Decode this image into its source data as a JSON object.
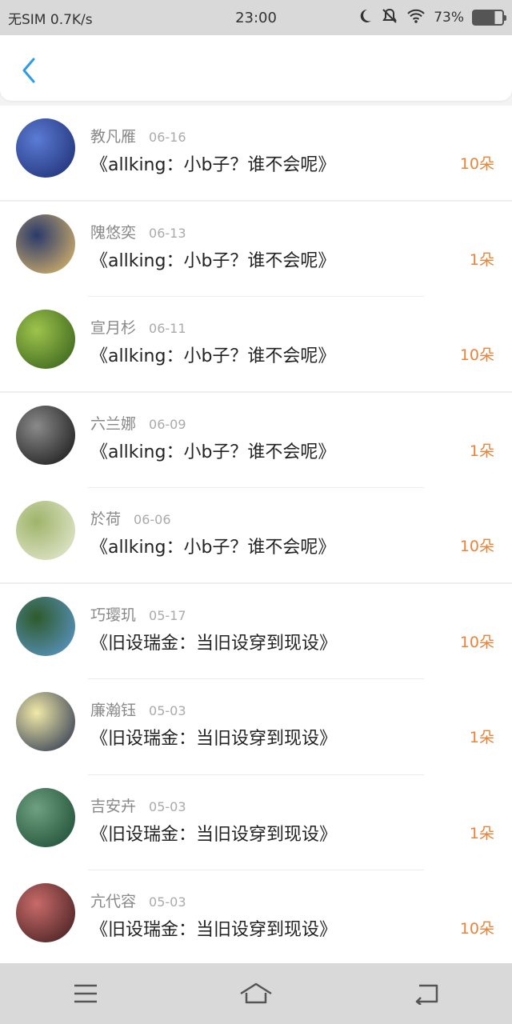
{
  "status_bar": {
    "carrier": "无SIM 0.7K/s",
    "time": "23:00",
    "battery": "73%"
  },
  "list": [
    {
      "name": "教凡雁",
      "date": "06-16",
      "title": "《allking：小b子？谁不会呢》",
      "gift": "10朵",
      "avatar_colors": [
        "#1a2a6c",
        "#5b7bd5"
      ]
    },
    {
      "name": "隗悠奕",
      "date": "06-13",
      "title": "《allking：小b子？谁不会呢》",
      "gift": "1朵",
      "avatar_colors": [
        "#e8c06a",
        "#2a3a6a"
      ]
    },
    {
      "name": "宣月杉",
      "date": "06-11",
      "title": "《allking：小b子？谁不会呢》",
      "gift": "10朵",
      "avatar_colors": [
        "#2f5a18",
        "#9ec44c"
      ]
    },
    {
      "name": "六兰娜",
      "date": "06-09",
      "title": "《allking：小b子？谁不会呢》",
      "gift": "1朵",
      "avatar_colors": [
        "#111111",
        "#8a8a8a"
      ]
    },
    {
      "name": "於荷",
      "date": "06-06",
      "title": "《allking：小b子？谁不会呢》",
      "gift": "10朵",
      "avatar_colors": [
        "#e9ecd8",
        "#9fb46a"
      ]
    },
    {
      "name": "巧璎玑",
      "date": "05-17",
      "title": "《旧设瑞金：当旧设穿到现设》",
      "gift": "10朵",
      "avatar_colors": [
        "#5e9bd6",
        "#2f5a2a"
      ]
    },
    {
      "name": "廉瀚钰",
      "date": "05-03",
      "title": "《旧设瑞金：当旧设穿到现设》",
      "gift": "1朵",
      "avatar_colors": [
        "#1e2a4a",
        "#f1e9a8"
      ]
    },
    {
      "name": "吉安卉",
      "date": "05-03",
      "title": "《旧设瑞金：当旧设穿到现设》",
      "gift": "1朵",
      "avatar_colors": [
        "#16472f",
        "#6fa080"
      ]
    },
    {
      "name": "亢代容",
      "date": "05-03",
      "title": "《旧设瑞金：当旧设穿到现设》",
      "gift": "10朵",
      "avatar_colors": [
        "#3a1a1a",
        "#c96a6a"
      ]
    }
  ],
  "colors": {
    "accent_blue": "#2f9be8",
    "gift_orange": "#e8843a"
  },
  "icons": {
    "back": "chevron-left-icon",
    "menu": "menu-icon",
    "home": "home-icon",
    "return": "return-icon"
  }
}
